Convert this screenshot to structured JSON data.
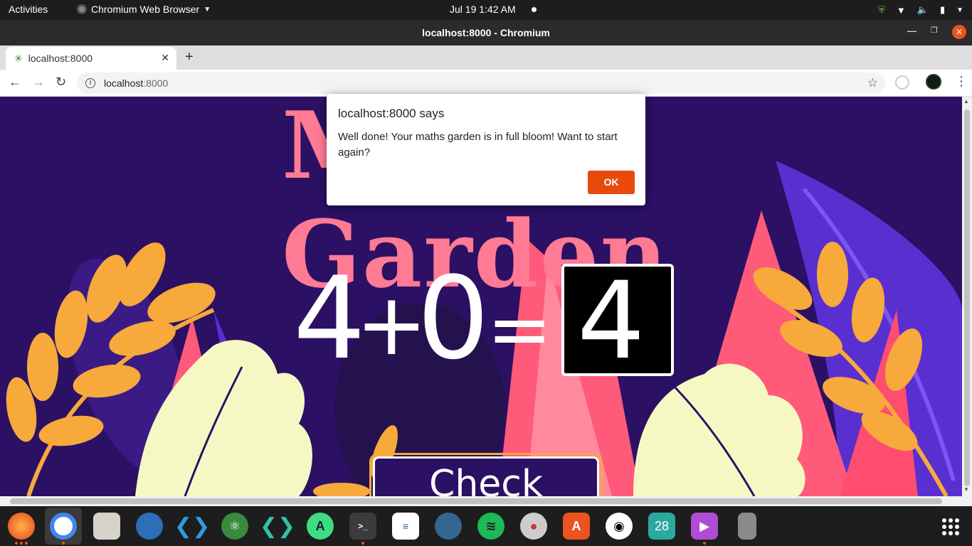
{
  "topbar": {
    "activities": "Activities",
    "app_menu": "Chromium Web Browser",
    "clock": "Jul 19   1:42 AM"
  },
  "window": {
    "title": "localhost:8000 - Chromium",
    "tab_title": "localhost:8000",
    "url_host": "localhost",
    "url_port": ":8000"
  },
  "page": {
    "heading": "Maths Garden",
    "equation": {
      "left": "4",
      "op": "+",
      "right": "0",
      "eq": "="
    },
    "drawn_answer": "4",
    "check_button": "Check Answer"
  },
  "dialog": {
    "title": "localhost:8000 says",
    "message": "Well done! Your maths garden is in full bloom! Want to start again?",
    "ok": "OK"
  },
  "dock": {
    "calendar_day": "28"
  },
  "colors": {
    "page_bg": "#2b1064",
    "accent_pink": "#ff5a7a",
    "leaf_orange": "#f7a93b",
    "leaf_cream": "#f6f8c3",
    "ok_button": "#e84a0c"
  }
}
